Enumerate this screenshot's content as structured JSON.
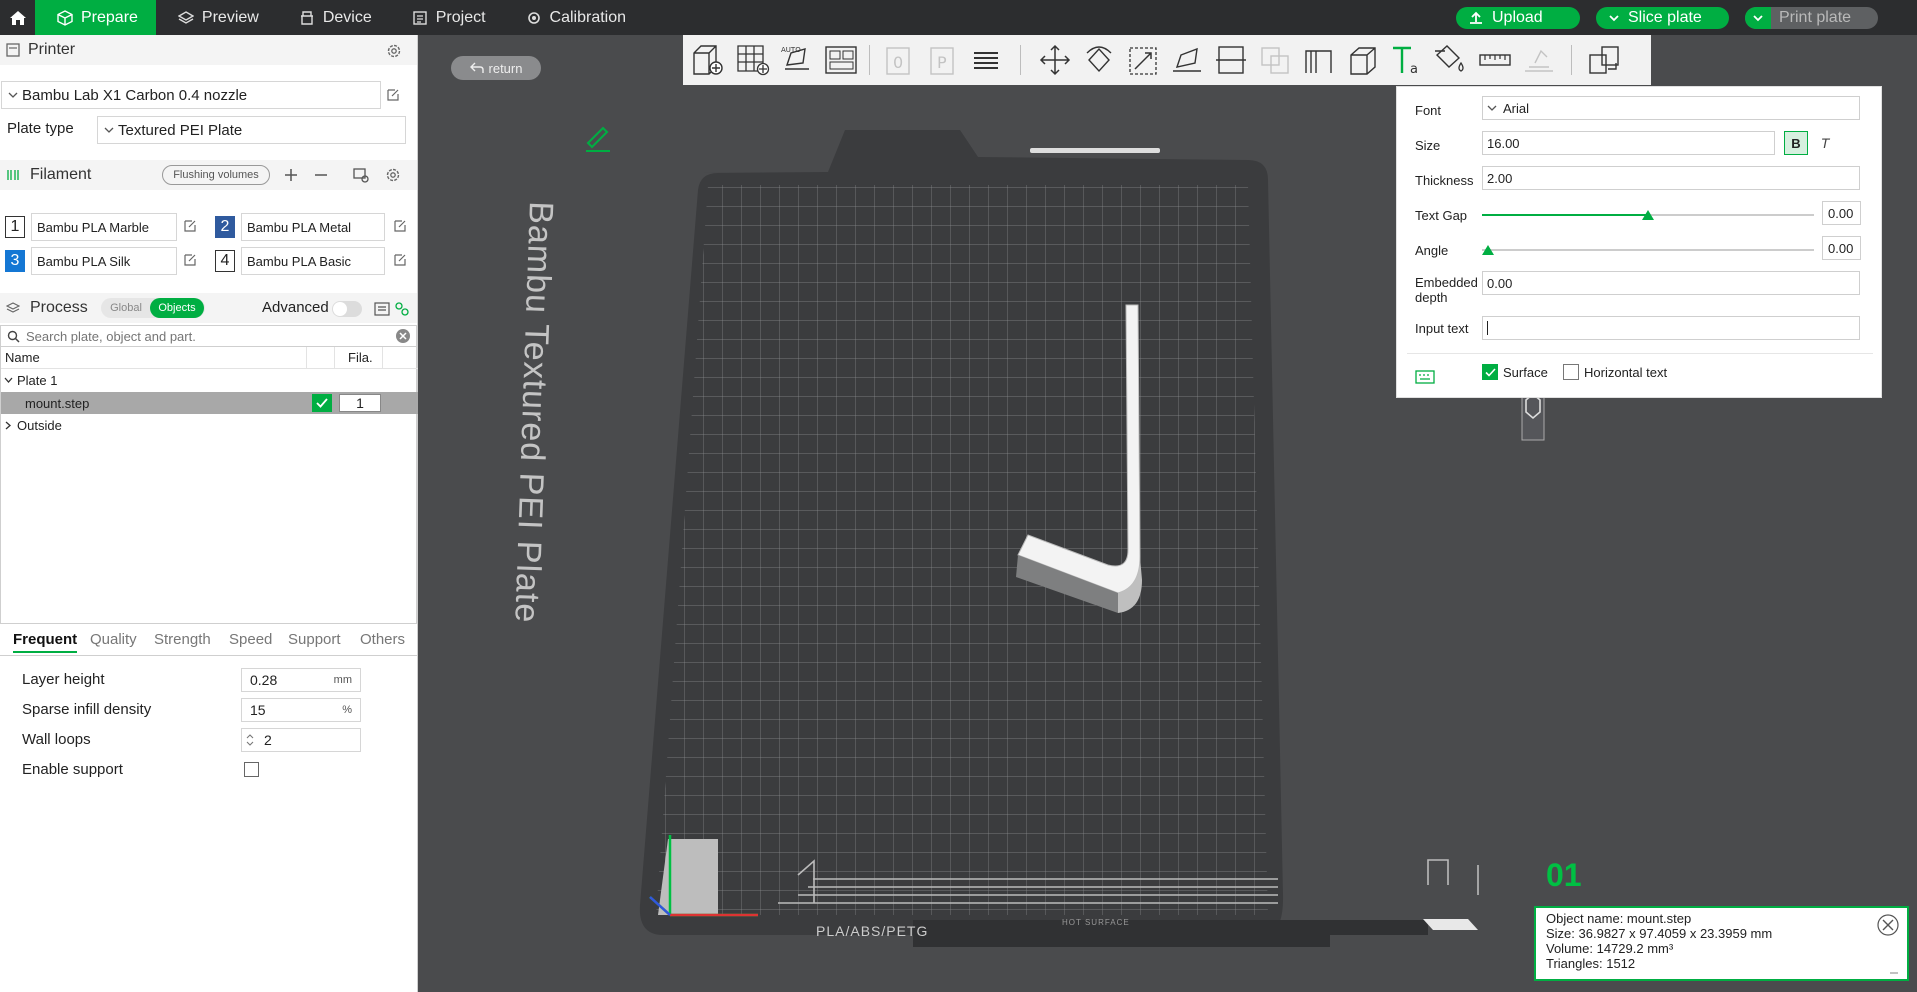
{
  "topbar": {
    "tabs": [
      {
        "label": "Prepare",
        "icon": "cube-icon"
      },
      {
        "label": "Preview",
        "icon": "layers-icon"
      },
      {
        "label": "Device",
        "icon": "device-icon"
      },
      {
        "label": "Project",
        "icon": "project-icon"
      },
      {
        "label": "Calibration",
        "icon": "calibration-icon"
      }
    ],
    "upload_label": "Upload",
    "slice_label": "Slice plate",
    "print_label": "Print plate"
  },
  "printer": {
    "section_title": "Printer",
    "name": "Bambu Lab X1 Carbon 0.4 nozzle",
    "plate_type_label": "Plate type",
    "plate_type": "Textured PEI Plate"
  },
  "filament": {
    "section_title": "Filament",
    "flushing_label": "Flushing volumes",
    "items": [
      {
        "num": "1",
        "name": "Bambu PLA Marble",
        "color": "#ffffff"
      },
      {
        "num": "2",
        "name": "Bambu PLA Metal",
        "color": "#2f5a9e"
      },
      {
        "num": "3",
        "name": "Bambu PLA Silk",
        "color": "#1477d4"
      },
      {
        "num": "4",
        "name": "Bambu PLA Basic",
        "color": "#ffffff"
      }
    ]
  },
  "process": {
    "section_title": "Process",
    "global_label": "Global",
    "objects_label": "Objects",
    "advanced_label": "Advanced"
  },
  "search": {
    "placeholder": "Search plate, object and part."
  },
  "objects": {
    "col_name": "Name",
    "col_fila": "Fila.",
    "plate_label": "Plate 1",
    "object_name": "mount.step",
    "object_fila": "1",
    "outside_label": "Outside"
  },
  "param_tabs": [
    "Frequent",
    "Quality",
    "Strength",
    "Speed",
    "Support",
    "Others"
  ],
  "params": {
    "layer_height_label": "Layer height",
    "layer_height_value": "0.28",
    "layer_height_unit": "mm",
    "infill_label": "Sparse infill density",
    "infill_value": "15",
    "infill_unit": "%",
    "wall_loops_label": "Wall loops",
    "wall_loops_value": "2",
    "support_label": "Enable support"
  },
  "viewport": {
    "return_label": "return",
    "plate_text": "Bambu Textured PEI Plate",
    "plate_number": "01",
    "bed_label": "PLA/ABS/PETG",
    "hot_surface_label": "HOT SURFACE"
  },
  "text_tool": {
    "font_label": "Font",
    "font_value": "Arial",
    "size_label": "Size",
    "size_value": "16.00",
    "bold_label": "B",
    "italic_label": "T",
    "thickness_label": "Thickness",
    "thickness_value": "2.00",
    "gap_label": "Text Gap",
    "gap_value": "0.00",
    "angle_label": "Angle",
    "angle_value": "0.00",
    "embedded_label": "Embedded depth",
    "embedded_value": "0.00",
    "input_label": "Input text",
    "input_value": "",
    "surface_label": "Surface",
    "horizontal_label": "Horizontal text"
  },
  "object_info": {
    "name_line": "Object name: mount.step",
    "size_line": "Size: 36.9827 x 97.4059 x 23.3959 mm",
    "volume_line": "Volume: 14729.2 mm³",
    "triangles_line": "Triangles: 1512"
  },
  "colors": {
    "accent": "#00ae42",
    "topbar": "#2c2d2f",
    "viewport": "#4a4b4d"
  }
}
